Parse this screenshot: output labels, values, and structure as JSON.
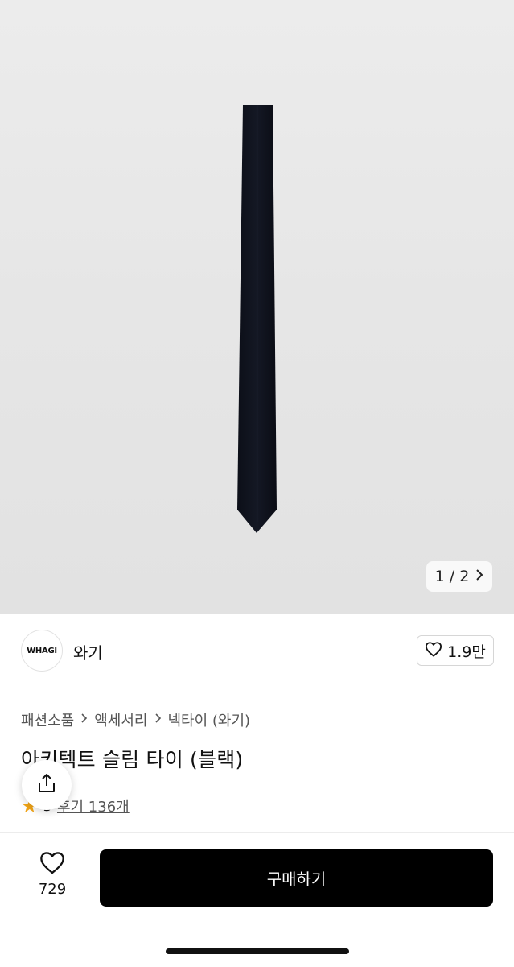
{
  "gallery": {
    "pager_text": "1 / 2"
  },
  "brand": {
    "logo_text": "WHAGI",
    "name": "와기",
    "like_count": "1.9만"
  },
  "breadcrumb": {
    "items": [
      "패션소품",
      "액세서리",
      "넥타이 (와기)"
    ]
  },
  "product": {
    "title": "아키텍트 슬림 타이 (블랙)",
    "rating": "5",
    "review_text": "후기 136개"
  },
  "bottom": {
    "wish_count": "729",
    "buy_label": "구매하기"
  },
  "colors": {
    "accent_star": "#f2a516",
    "buy_button": "#000000"
  },
  "icons": [
    "share-icon",
    "heart-icon",
    "chevron-right-icon",
    "star-icon"
  ]
}
